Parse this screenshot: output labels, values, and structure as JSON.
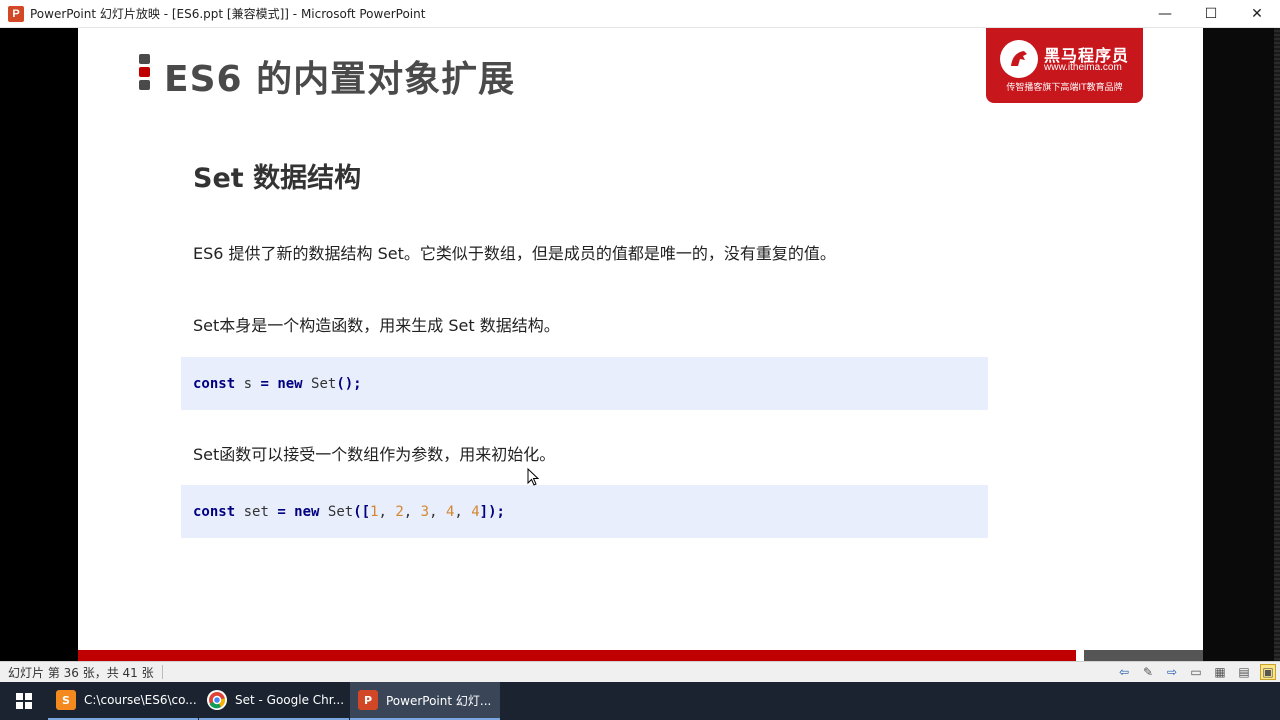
{
  "window": {
    "title": "PowerPoint 幻灯片放映 - [ES6.ppt [兼容模式]] - Microsoft PowerPoint",
    "app_icon_letter": "P",
    "minimize": "—",
    "maximize": "☐",
    "close": "✕"
  },
  "slide": {
    "title": "ES6 的内置对象扩展",
    "logo": {
      "name": "黑马程序员",
      "url": "www.itheima.com",
      "tagline": "传智播客旗下高端IT教育品牌"
    },
    "section_title": "Set 数据结构",
    "para1": "ES6 提供了新的数据结构 Set。它类似于数组，但是成员的值都是唯一的，没有重复的值。",
    "para2": "Set本身是一个构造函数，用来生成 Set  数据结构。",
    "para3": "Set函数可以接受一个数组作为参数，用来初始化。",
    "code1": {
      "kw1": "const",
      "var": " s ",
      "eq": "=",
      "kw2": " new",
      "rest": " Set",
      "tail": "();"
    },
    "code2": {
      "kw1": "const",
      "var": " set ",
      "eq": "=",
      "kw2": " new",
      "fn": " Set",
      "open": "([",
      "n1": "1",
      "n2": "2",
      "n3": "3",
      "n4": "4",
      "n5": "4",
      "sep": ", ",
      "close": "]);"
    }
  },
  "statusbar": {
    "slide_count": "幻灯片 第 36 张，共 41 张"
  },
  "taskbar": {
    "items": [
      {
        "label": "C:\\course\\ES6\\co..."
      },
      {
        "label": "Set - Google Chr..."
      },
      {
        "label": "PowerPoint 幻灯..."
      }
    ]
  },
  "colors": {
    "accent_red": "#c00000",
    "logo_red": "#c8161d",
    "code_bg": "#e8eefc"
  }
}
